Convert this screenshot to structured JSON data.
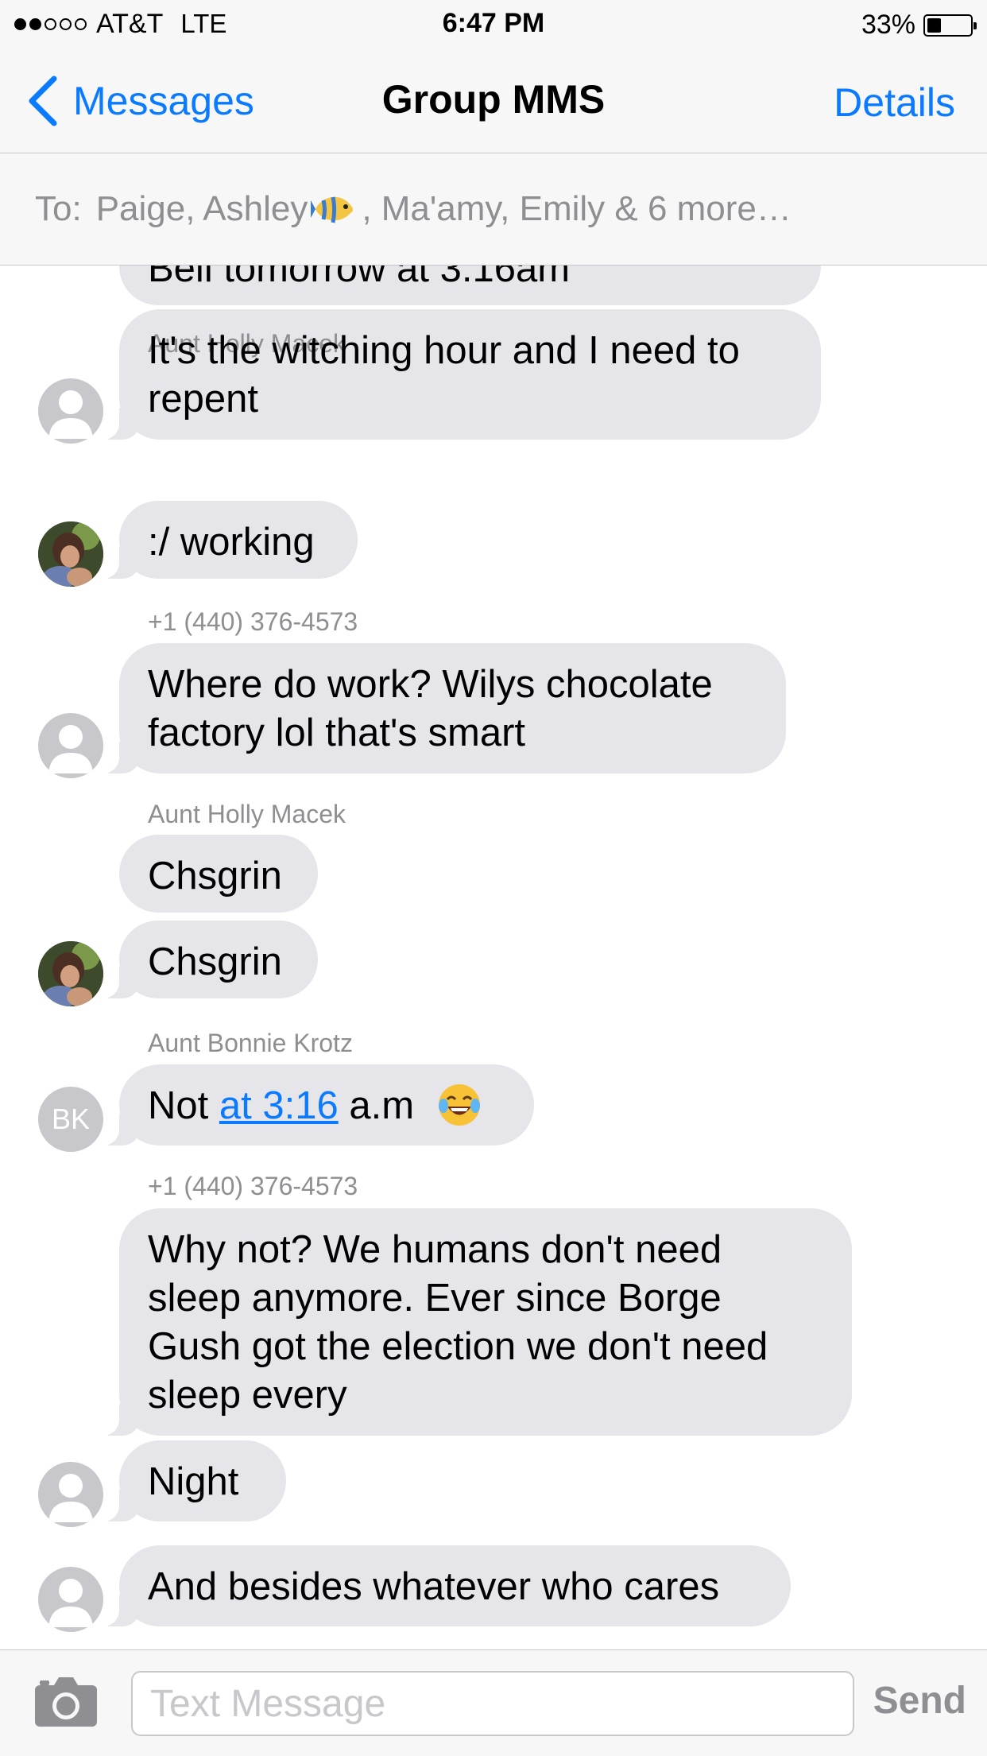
{
  "status_bar": {
    "signal_bars_filled": 2,
    "signal_bars_total": 5,
    "carrier": "AT&T",
    "network": "LTE",
    "time": "6:47 PM",
    "battery_percent_label": "33%",
    "battery_level": 0.33
  },
  "nav": {
    "back_label": "Messages",
    "title": "Group MMS",
    "details_label": "Details"
  },
  "recipients": {
    "to_label": "To:",
    "names_before_icon": "Paige, Ashley",
    "icon": "tropical-fish-emoji",
    "names_after_icon": ", Ma'amy, Emily & 6 more…"
  },
  "messages": [
    {
      "text": "Bell tomorrow at 3:16am"
    },
    {
      "text": "It's the witching hour and I need to repent",
      "avatar": "generic"
    },
    {
      "sender": "Aunt Holly Macek"
    },
    {
      "text": ":/ working",
      "avatar": "photo"
    },
    {
      "sender": "+1 (440) 376-4573"
    },
    {
      "text": "Where do work? Wilys chocolate factory lol that's smart",
      "avatar": "generic"
    },
    {
      "sender": "Aunt Holly Macek"
    },
    {
      "text": "Chsgrin"
    },
    {
      "text": "Chsgrin",
      "avatar": "photo"
    },
    {
      "sender": "Aunt Bonnie Krotz"
    },
    {
      "text_before_link": "Not ",
      "link": "at 3:16",
      "text_after_link": " a.m",
      "emoji": "face-with-tears-of-joy",
      "avatar_initials": "BK"
    },
    {
      "sender": "+1 (440) 376-4573"
    },
    {
      "text": "Why not? We humans don't need sleep anymore. Ever since Borge Gush got the election we don't need sleep every",
      "avatar": "generic"
    },
    {
      "text": "Night",
      "avatar": "generic"
    },
    {
      "text": "And besides whatever who cares",
      "avatar": "generic"
    }
  ],
  "input": {
    "camera_icon": "camera-icon",
    "placeholder": "Text Message",
    "value": "",
    "send_label": "Send"
  },
  "colors": {
    "accent": "#0a7aff",
    "bubble_incoming": "#e5e5ea",
    "secondary_text": "#8e8e93",
    "bar_background": "#f7f7f7"
  }
}
